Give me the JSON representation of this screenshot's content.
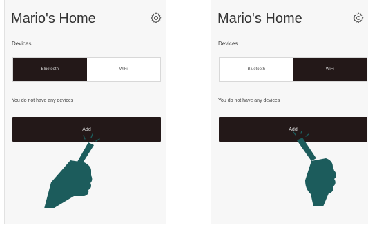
{
  "screens": [
    {
      "title": "Mario's Home",
      "settings_icon": "gear-icon",
      "section_label": "Devices",
      "tabs": [
        {
          "label": "Bluetooth",
          "active": true
        },
        {
          "label": "WiFi",
          "active": false
        }
      ],
      "empty_message": "You do not have any devices",
      "add_button_label": "Add",
      "gesture_icon": "pointing-hand-icon"
    },
    {
      "title": "Mario's Home",
      "settings_icon": "gear-icon",
      "section_label": "Devices",
      "tabs": [
        {
          "label": "Bluetooth",
          "active": false
        },
        {
          "label": "WiFi",
          "active": true
        }
      ],
      "empty_message": "You do not have any devices",
      "add_button_label": "Add",
      "gesture_icon": "pointing-hand-icon"
    }
  ],
  "colors": {
    "active_dark": "#231818",
    "hand": "#1c5c5c",
    "background": "#f7f7f7"
  }
}
